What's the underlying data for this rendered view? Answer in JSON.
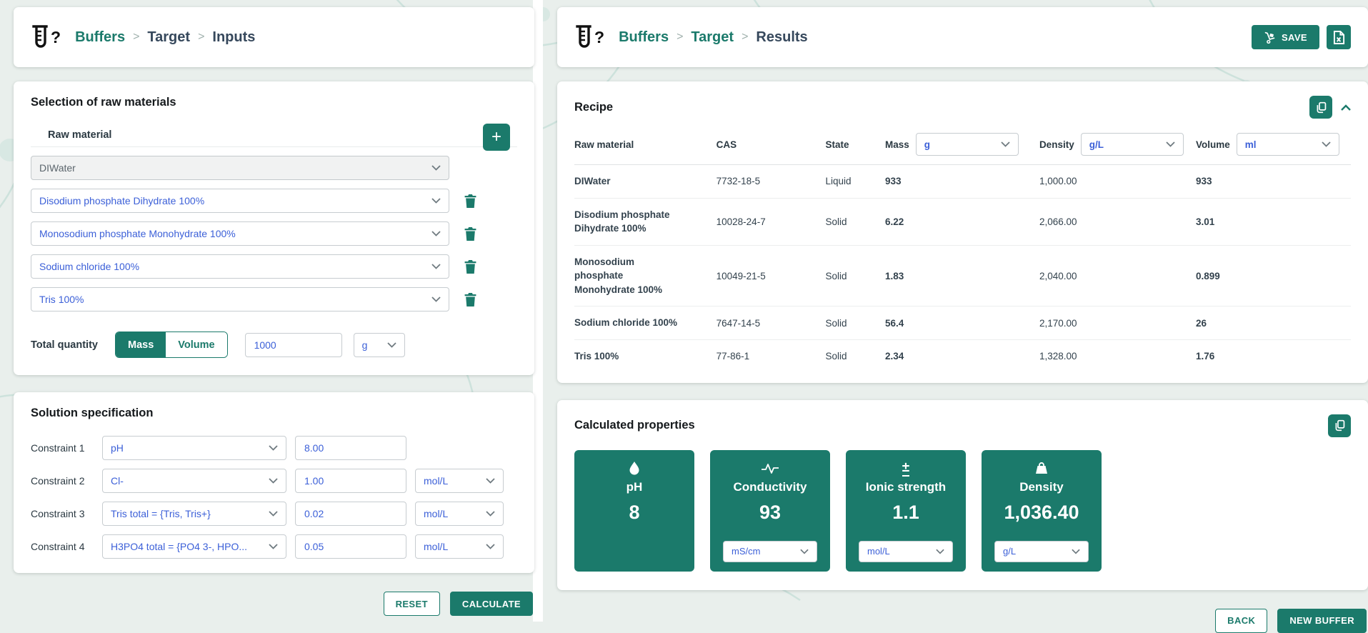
{
  "theme": {
    "accent_teal": "#1b7a6b",
    "link_blue": "#3c60d8",
    "dark_text": "#33424d"
  },
  "breadcrumb_separator": ">",
  "left": {
    "breadcrumb": {
      "items": [
        "Buffers",
        "Target",
        "Inputs"
      ]
    },
    "raw_card": {
      "title": "Selection of raw materials",
      "column_label": "Raw material",
      "add_button_label": "+",
      "materials": [
        {
          "value": "DIWater",
          "disabled": true
        },
        {
          "value": "Disodium phosphate Dihydrate 100%"
        },
        {
          "value": "Monosodium phosphate Monohydrate 100%"
        },
        {
          "value": "Sodium chloride 100%"
        },
        {
          "value": "Tris 100%"
        }
      ],
      "total_quantity": {
        "label": "Total quantity",
        "mass_label": "Mass",
        "volume_label": "Volume",
        "selected_mode": "Mass",
        "value": "1000",
        "unit": "g"
      }
    },
    "solution_card": {
      "title": "Solution specification",
      "constraints": [
        {
          "label": "Constraint 1",
          "parameter": "pH",
          "value": "8.00"
        },
        {
          "label": "Constraint 2",
          "parameter": "Cl-",
          "value": "1.00",
          "unit": "mol/L"
        },
        {
          "label": "Constraint 3",
          "parameter": "Tris  total = {Tris, Tris+}",
          "value": "0.02",
          "unit": "mol/L"
        },
        {
          "label": "Constraint 4",
          "parameter": "H3PO4  total = {PO4 3-, HPO...",
          "value": "0.05",
          "unit": "mol/L"
        }
      ]
    },
    "footer": {
      "reset": "RESET",
      "calculate": "CALCULATE"
    }
  },
  "right": {
    "breadcrumb": {
      "items": [
        "Buffers",
        "Target",
        "Results"
      ]
    },
    "save_button_label": "SAVE",
    "recipe": {
      "title": "Recipe",
      "headers": {
        "raw_material": "Raw material",
        "cas": "CAS",
        "state": "State",
        "mass": "Mass",
        "density": "Density",
        "volume": "Volume"
      },
      "units": {
        "mass": "g",
        "density": "g/L",
        "volume": "ml"
      },
      "rows": [
        {
          "name": "DIWater",
          "cas": "7732-18-5",
          "state": "Liquid",
          "mass": "933",
          "density": "1,000.00",
          "volume": "933"
        },
        {
          "name": "Disodium phosphate Dihydrate 100%",
          "cas": "10028-24-7",
          "state": "Solid",
          "mass": "6.22",
          "density": "2,066.00",
          "volume": "3.01"
        },
        {
          "name": "Monosodium phosphate Monohydrate 100%",
          "cas": "10049-21-5",
          "state": "Solid",
          "mass": "1.83",
          "density": "2,040.00",
          "volume": "0.899"
        },
        {
          "name": "Sodium chloride 100%",
          "cas": "7647-14-5",
          "state": "Solid",
          "mass": "56.4",
          "density": "2,170.00",
          "volume": "26"
        },
        {
          "name": "Tris 100%",
          "cas": "77-86-1",
          "state": "Solid",
          "mass": "2.34",
          "density": "1,328.00",
          "volume": "1.76"
        }
      ]
    },
    "properties": {
      "title": "Calculated properties",
      "tiles": [
        {
          "label": "pH",
          "value": "8",
          "icon": "droplet-icon"
        },
        {
          "label": "Conductivity",
          "value": "93",
          "unit": "mS/cm",
          "icon": "pulse-icon"
        },
        {
          "label": "Ionic strength",
          "value": "1.1",
          "unit": "mol/L",
          "icon": "plus-minus-icon"
        },
        {
          "label": "Density",
          "value": "1,036.40",
          "unit": "g/L",
          "icon": "weight-icon"
        }
      ]
    },
    "footer": {
      "back": "BACK",
      "new_buffer": "NEW BUFFER"
    }
  }
}
